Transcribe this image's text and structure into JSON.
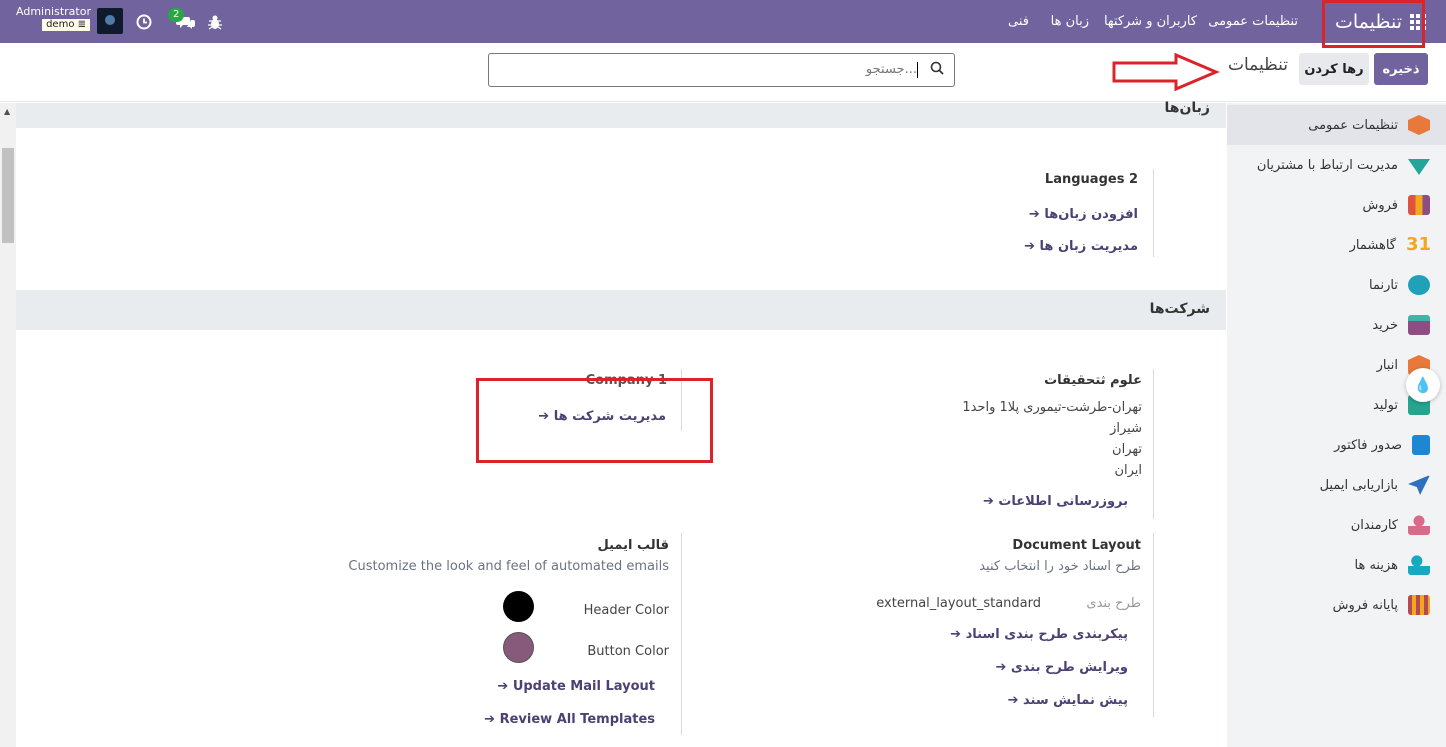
{
  "navbar": {
    "app_title": "تنظیمات",
    "menu": [
      "تنظیمات عمومی",
      "کاربران و شرکتها",
      "زبان ها",
      "فنی"
    ],
    "user_name": "Administrator",
    "database": "demo",
    "message_count": "2",
    "icons": [
      "apps-grid-icon",
      "clock-icon",
      "chat-icon",
      "bug-icon"
    ]
  },
  "control_panel": {
    "save_label": "ذخیره",
    "discard_label": "رها کردن",
    "title": "تنظیمات",
    "search_placeholder": "جستجو..."
  },
  "sidebar": {
    "items": [
      {
        "label": "تنظیمات عمومی",
        "icon": "settings-app-icon",
        "color": "#e8793a",
        "active": true
      },
      {
        "label": "مدیریت ارتباط با مشتریان",
        "icon": "crm-icon",
        "color": "#24a59a"
      },
      {
        "label": "فروش",
        "icon": "sales-icon",
        "color": "#e0533a"
      },
      {
        "label": "گاهشمار",
        "icon": "calendar-icon",
        "color": "#f2a81e"
      },
      {
        "label": "تارنما",
        "icon": "website-icon",
        "color": "#1fa2b8"
      },
      {
        "label": "خرید",
        "icon": "purchase-icon",
        "color": "#8e4d83"
      },
      {
        "label": "انبار",
        "icon": "inventory-icon",
        "color": "#e8793a"
      },
      {
        "label": "تولید",
        "icon": "manufacturing-icon",
        "color": "#25a58e"
      },
      {
        "label": "صدور فاکتور",
        "icon": "invoicing-icon",
        "color": "#1c88d3"
      },
      {
        "label": "بازاریابی ایمیل",
        "icon": "email-marketing-icon",
        "color": "#2f6fbf"
      },
      {
        "label": "کارمندان",
        "icon": "employees-icon",
        "color": "#d86b8c"
      },
      {
        "label": "هزینه ها",
        "icon": "expenses-icon",
        "color": "#1aa7c2"
      },
      {
        "label": "پایانه فروش",
        "icon": "pos-icon",
        "color": "#b5494f"
      }
    ]
  },
  "languages": {
    "header": "زبان‌ها",
    "count_label": "Languages 2",
    "add_link": "افزودن زبان‌ها",
    "manage_link": "مدیریت زبان ها"
  },
  "companies": {
    "header": "شرکت‌ها",
    "company_name": "علوم ثتحقیقات",
    "address": [
      "تهران-طرشت-تیموری پلا1 واحد1",
      "شیراز",
      "تهران",
      "ایران"
    ],
    "update_link": "بروزرسانی اطلاعات",
    "company_count": "Company 1",
    "manage_link": "مدیریت شرکت ها"
  },
  "document_layout": {
    "title": "Document Layout",
    "description": "طرح اسناد خود را انتخاب کنید",
    "layout_label": "طرح بندی",
    "layout_value": "external_layout_standard",
    "configure_link": "پیکربندی طرح بندی اسناد",
    "edit_link": "ویرایش طرح بندی",
    "preview_link": "پیش نمایش سند"
  },
  "email_template": {
    "title": "قالب ایمیل",
    "description": "Customize the look and feel of automated emails",
    "header_color_label": "Header Color",
    "header_color": "#000000",
    "button_color_label": "Button Color",
    "button_color": "#875a7b",
    "update_link": "Update Mail Layout",
    "review_link": "Review All Templates"
  },
  "colors": {
    "brand": "#71639e",
    "link": "#4b4173",
    "annotation": "#d9252a"
  }
}
